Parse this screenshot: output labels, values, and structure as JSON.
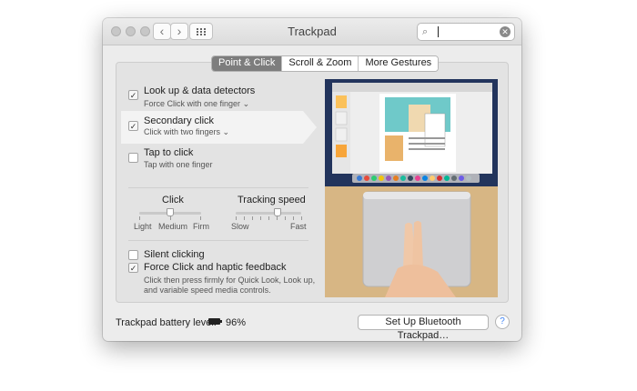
{
  "window": {
    "title": "Trackpad",
    "back_glyph": "‹",
    "forward_glyph": "›",
    "search_placeholder": ""
  },
  "tabs": [
    {
      "label": "Point & Click",
      "active": true
    },
    {
      "label": "Scroll & Zoom",
      "active": false
    },
    {
      "label": "More Gestures",
      "active": false
    }
  ],
  "options": [
    {
      "label": "Look up & data detectors",
      "sub": "Force Click with one finger",
      "checked": true,
      "has_dropdown": true
    },
    {
      "label": "Secondary click",
      "sub": "Click with two fingers",
      "checked": true,
      "has_dropdown": true
    },
    {
      "label": "Tap to click",
      "sub": "Tap with one finger",
      "checked": false,
      "has_dropdown": false
    }
  ],
  "click_slider": {
    "label": "Click",
    "ticks": [
      "Light",
      "Medium",
      "Firm"
    ],
    "value_fraction": 0.5
  },
  "tracking_slider": {
    "label": "Tracking speed",
    "min_label": "Slow",
    "max_label": "Fast",
    "value_fraction": 0.67
  },
  "bottom_options": [
    {
      "label": "Silent clicking",
      "checked": false
    },
    {
      "label": "Force Click and haptic feedback",
      "checked": true
    }
  ],
  "force_desc_line1": "Click then press firmly for Quick Look, Look up,",
  "force_desc_line2": "and variable speed media controls.",
  "footer": {
    "battery_label": "Trackpad battery level:",
    "battery_pct": "96%",
    "setup_button": "Set Up Bluetooth Trackpad…",
    "help": "?"
  },
  "checkmark": "✓",
  "dropdown_glyph": "⌄",
  "colors": {
    "window_bg": "#ececec",
    "active_tab": "#7d7d7d",
    "desktop_bg": "#1c2a4a",
    "trackpad_table": "#d8b88c"
  }
}
